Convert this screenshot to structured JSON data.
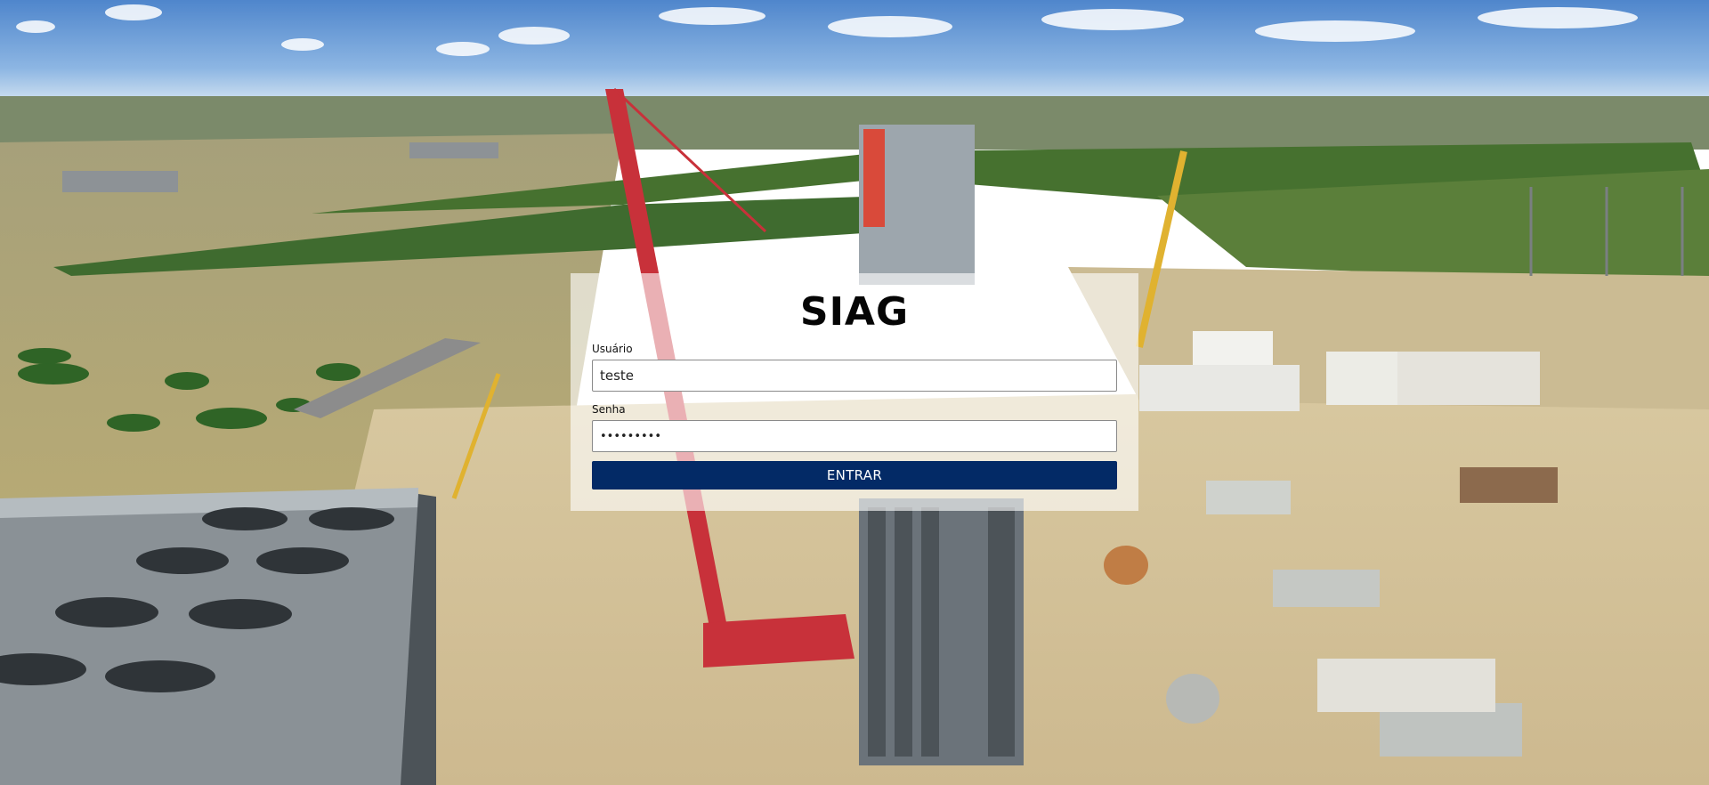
{
  "login": {
    "title": "SIAG",
    "username": {
      "label": "Usuário",
      "value": "teste"
    },
    "password": {
      "label": "Senha",
      "value": "teste1234"
    },
    "submit_label": "ENTRAR"
  },
  "colors": {
    "button": "#032a66",
    "sky": "#5b8fd0",
    "ground": "#d9c9a4"
  }
}
